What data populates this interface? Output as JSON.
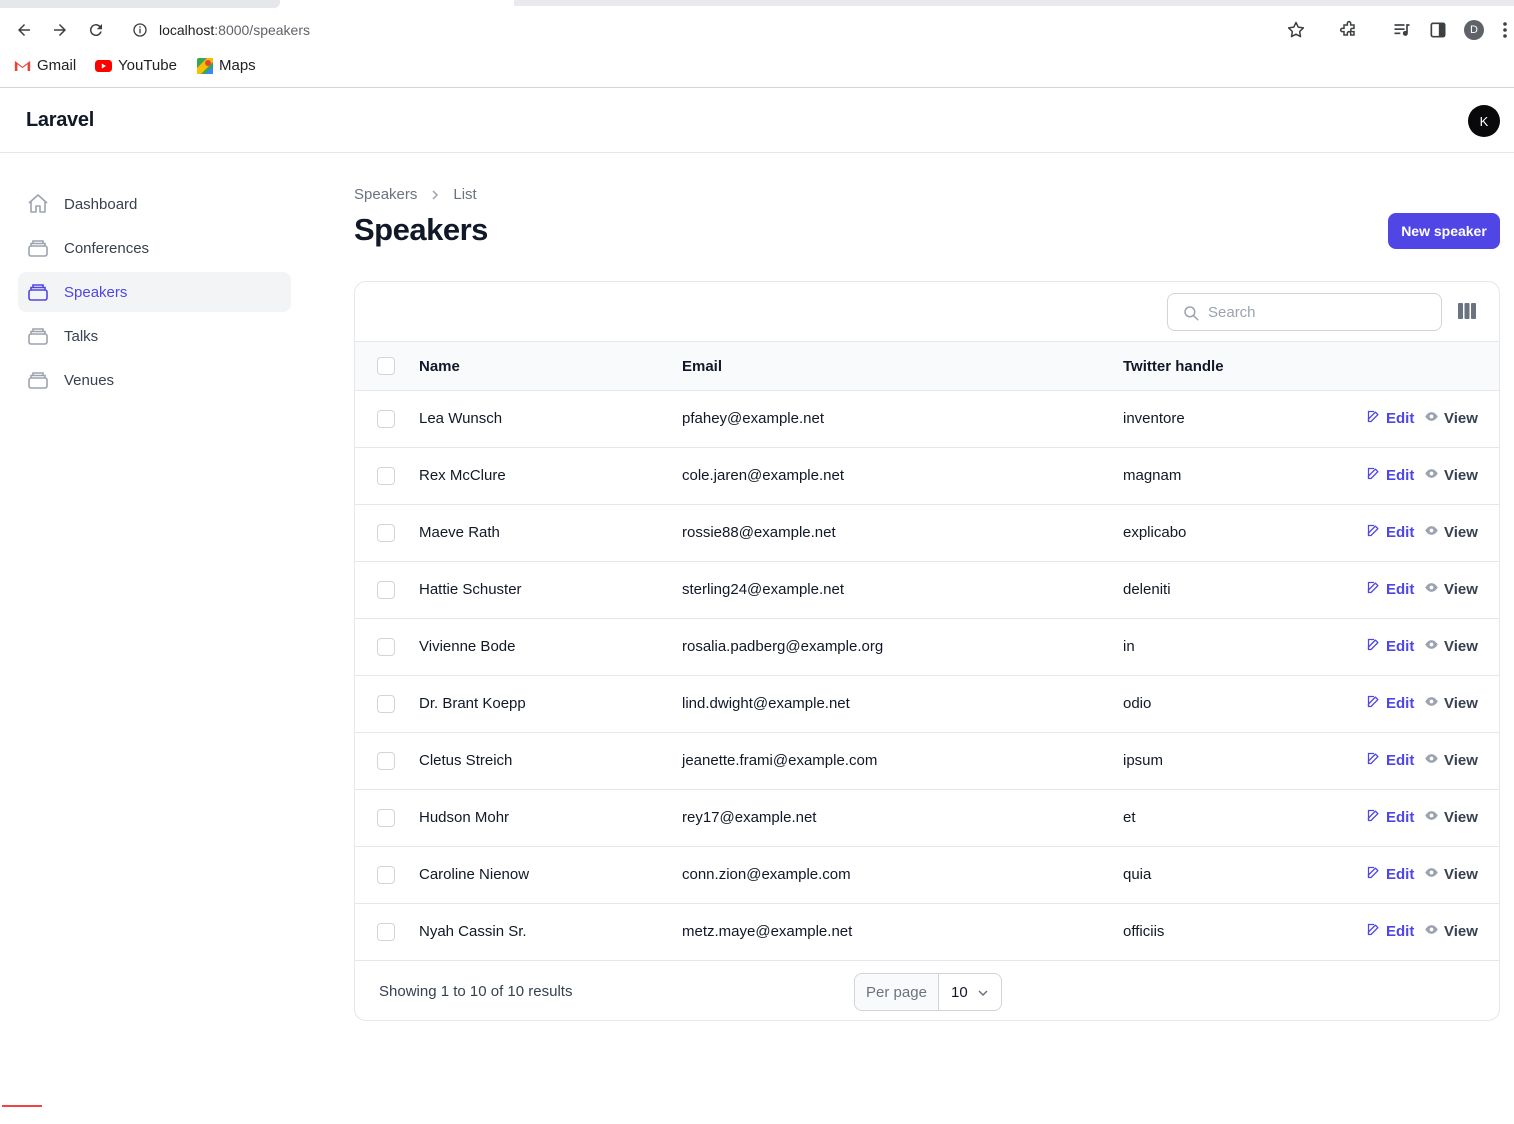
{
  "browser": {
    "url_host": "localhost",
    "url_path": ":8000/speakers",
    "profile_initial": "D",
    "bookmarks": [
      {
        "label": "Gmail",
        "icon": "gmail-icon"
      },
      {
        "label": "YouTube",
        "icon": "youtube-icon"
      },
      {
        "label": "Maps",
        "icon": "maps-icon"
      }
    ]
  },
  "app": {
    "brand": "Laravel",
    "user_initial": "K",
    "accent_color": "#4f46e5"
  },
  "sidebar": {
    "items": [
      {
        "label": "Dashboard",
        "icon": "home-icon",
        "active": false
      },
      {
        "label": "Conferences",
        "icon": "collection-icon",
        "active": false
      },
      {
        "label": "Speakers",
        "icon": "collection-icon",
        "active": true
      },
      {
        "label": "Talks",
        "icon": "collection-icon",
        "active": false
      },
      {
        "label": "Venues",
        "icon": "collection-icon",
        "active": false
      }
    ]
  },
  "page": {
    "breadcrumb": [
      "Speakers",
      "List"
    ],
    "title": "Speakers",
    "new_button": "New speaker"
  },
  "table": {
    "search_placeholder": "Search",
    "columns": [
      "Name",
      "Email",
      "Twitter handle"
    ],
    "edit_label": "Edit",
    "view_label": "View",
    "rows": [
      {
        "name": "Lea Wunsch",
        "email": "pfahey@example.net",
        "twitter": "inventore"
      },
      {
        "name": "Rex McClure",
        "email": "cole.jaren@example.net",
        "twitter": "magnam"
      },
      {
        "name": "Maeve Rath",
        "email": "rossie88@example.net",
        "twitter": "explicabo"
      },
      {
        "name": "Hattie Schuster",
        "email": "sterling24@example.net",
        "twitter": "deleniti"
      },
      {
        "name": "Vivienne Bode",
        "email": "rosalia.padberg@example.org",
        "twitter": "in"
      },
      {
        "name": "Dr. Brant Koepp",
        "email": "lind.dwight@example.net",
        "twitter": "odio"
      },
      {
        "name": "Cletus Streich",
        "email": "jeanette.frami@example.com",
        "twitter": "ipsum"
      },
      {
        "name": "Hudson Mohr",
        "email": "rey17@example.net",
        "twitter": "et"
      },
      {
        "name": "Caroline Nienow",
        "email": "conn.zion@example.com",
        "twitter": "quia"
      },
      {
        "name": "Nyah Cassin Sr.",
        "email": "metz.maye@example.net",
        "twitter": "officiis"
      }
    ],
    "results_text": "Showing 1 to 10 of 10 results",
    "per_page_label": "Per page",
    "per_page_value": "10"
  }
}
